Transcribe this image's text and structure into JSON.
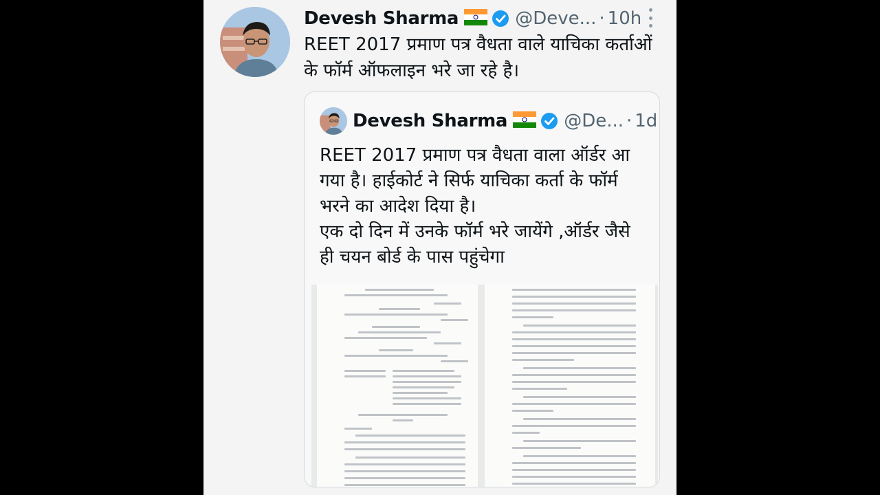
{
  "tweet": {
    "name": "Devesh Sharma",
    "flag_emoji": "🇮🇳",
    "handle": "@Deve...",
    "separator": "·",
    "time": "10h",
    "text": "REET 2017 प्रमाण पत्र वैधता वाले याचिका कर्ताओं के फॉर्म ऑफलाइन भरे जा रहे है।"
  },
  "quoted_tweet": {
    "name": "Devesh Sharma",
    "flag_emoji": "🇮🇳",
    "handle": "@De...",
    "separator": "·",
    "time": "1d",
    "text_para1": "REET 2017 प्रमाण पत्र वैधता वाला ऑर्डर आ गया है। हाईकोर्ट ने सिर्फ याचिका कर्ता के फॉर्म भरने का आदेश दिया है।",
    "text_para2": "एक दो दिन में उनके फॉर्म भरे जायेंगे ,ऑर्डर जैसे ही चयन बोर्ड के पास पहुंचेगा"
  },
  "icons": {
    "verified": "verified-badge-icon",
    "flag": "india-flag-icon",
    "more": "more-options-icon"
  },
  "colors": {
    "verified_blue": "#1d9bf0",
    "text_primary": "#0f1419",
    "text_secondary": "#536471",
    "saffron": "#ff9933",
    "green": "#138808",
    "chakra": "#000080"
  }
}
